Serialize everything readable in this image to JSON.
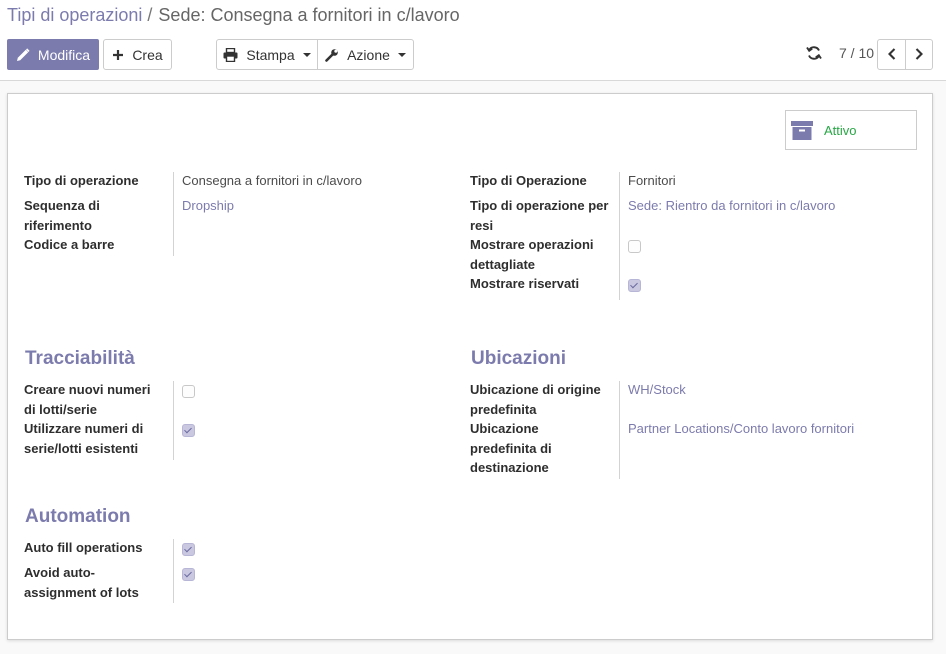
{
  "breadcrumb": {
    "parent": "Tipi di operazioni",
    "separator": "/",
    "current": "Sede: Consegna a fornitori in c/lavoro"
  },
  "toolbar": {
    "edit_label": "Modifica",
    "create_label": "Crea",
    "print_label": "Stampa",
    "action_label": "Azione"
  },
  "pager": {
    "value": "7 / 10"
  },
  "stat_button": {
    "label": "Attivo"
  },
  "left_fields": {
    "operation_type": {
      "label": "Tipo di operazione",
      "value": "Consegna a fornitori in c/lavoro"
    },
    "sequence": {
      "label": "Sequenza di riferimento",
      "value": "Dropship"
    },
    "barcode": {
      "label": "Codice a barre",
      "value": ""
    }
  },
  "right_fields": {
    "type": {
      "label": "Tipo di Operazione",
      "value": "Fornitori"
    },
    "return_type": {
      "label": "Tipo di operazione per resi",
      "value": "Sede: Rientro da fornitori in c/lavoro"
    },
    "show_detailed": {
      "label": "Mostrare operazioni dettagliate",
      "checked": false
    },
    "show_reserved": {
      "label": "Mostrare riservati",
      "checked": true
    }
  },
  "traceability": {
    "title": "Tracciabilità",
    "create_lots": {
      "label": "Creare nuovi numeri di lotti/serie",
      "checked": false
    },
    "use_existing_lots": {
      "label": "Utilizzare numeri di serie/lotti esistenti",
      "checked": true
    }
  },
  "locations": {
    "title": "Ubicazioni",
    "default_source": {
      "label": "Ubicazione di origine predefinita",
      "value": "WH/Stock"
    },
    "default_dest": {
      "label": "Ubicazione predefinita di destinazione",
      "value": "Partner Locations/Conto lavoro fornitori"
    }
  },
  "automation": {
    "title": "Automation",
    "auto_fill": {
      "label": "Auto fill operations",
      "checked": true
    },
    "avoid_lots": {
      "label": "Avoid auto-assignment of lots",
      "checked": true
    }
  },
  "colors": {
    "brand": "#7c7bad",
    "active_green": "#28a745"
  }
}
